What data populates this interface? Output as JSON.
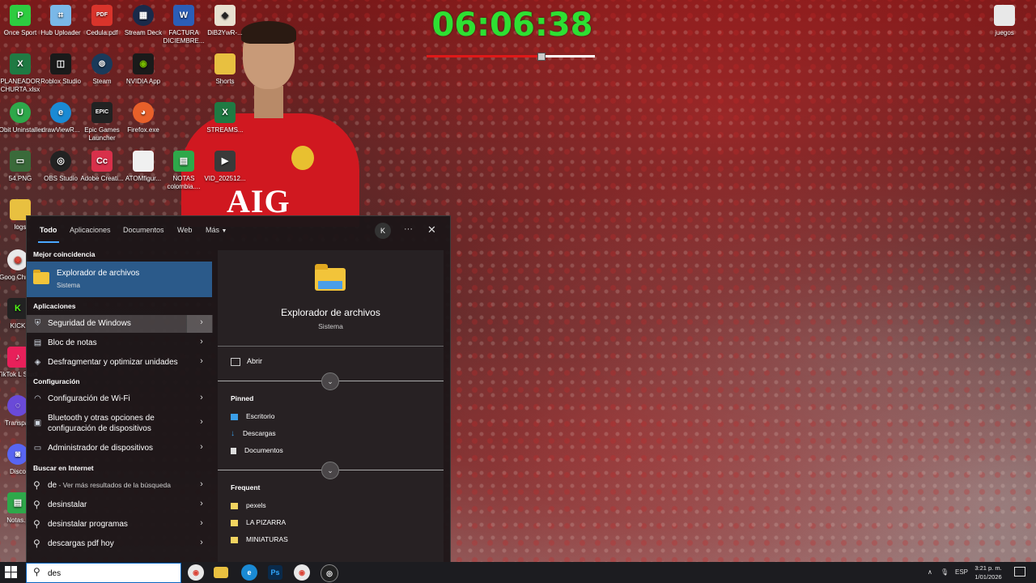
{
  "timer": {
    "value": "06:06:38",
    "progress": 0.68
  },
  "desktop": {
    "icons": [
      {
        "label": "Once Sport",
        "name": "once-sport-icon",
        "bg": "#2ecc40",
        "glyph": "P"
      },
      {
        "label": "Hub Uploader",
        "name": "hub-uploader-icon",
        "bg": "#7ab8e8",
        "glyph": "⌗"
      },
      {
        "label": "Cedula.pdf",
        "name": "pdf-file-icon",
        "bg": "#d9342b",
        "glyph": "PDF"
      },
      {
        "label": "Stream Deck",
        "name": "stream-deck-icon",
        "bg": "#1a2a4a",
        "glyph": "▦"
      },
      {
        "label": "FACTURA DICIEMBRE...",
        "name": "word-doc-icon",
        "bg": "#2b5eb8",
        "glyph": "W"
      },
      {
        "label": "DiB2YwR-...",
        "name": "image-file-icon",
        "bg": "#e8e0d0",
        "glyph": "◆"
      },
      {
        "label": "PLANEADOR CHURTA.xlsx",
        "name": "excel-file-icon",
        "bg": "#1f7a43",
        "glyph": "X"
      },
      {
        "label": "Roblox Studio",
        "name": "roblox-studio-icon",
        "bg": "#1a1a1a",
        "glyph": "◫"
      },
      {
        "label": "Steam",
        "name": "steam-icon",
        "bg": "#1a3a5a",
        "glyph": "⊚"
      },
      {
        "label": "NVIDIA App",
        "name": "nvidia-icon",
        "bg": "#1a1a1a",
        "glyph": "◉"
      },
      {
        "label": "Shorts",
        "name": "folder-icon",
        "bg": "#e8c040",
        "glyph": ""
      },
      {
        "label": "IObit Uninstaller",
        "name": "iobit-uninstaller-icon",
        "bg": "#2ea84a",
        "glyph": "U"
      },
      {
        "label": "drawViewR...",
        "name": "edge-shortcut-icon",
        "bg": "#1a8ad4",
        "glyph": "e"
      },
      {
        "label": "Epic Games Launcher",
        "name": "epic-games-icon",
        "bg": "#222",
        "glyph": "EPIC"
      },
      {
        "label": "Firefox.exe",
        "name": "firefox-icon",
        "bg": "#e8602a",
        "glyph": "◕"
      },
      {
        "label": "STREAMS...",
        "name": "excel-file-icon",
        "bg": "#1f7a43",
        "glyph": "X"
      },
      {
        "label": "54.PNG",
        "name": "image-file-icon",
        "bg": "#3a6a3a",
        "glyph": "▭"
      },
      {
        "label": "OBS Studio",
        "name": "obs-studio-icon",
        "bg": "#222",
        "glyph": "◎"
      },
      {
        "label": "Adobe Creati...",
        "name": "adobe-creative-icon",
        "bg": "#d8304a",
        "glyph": "Cc"
      },
      {
        "label": "ATOMfigur...",
        "name": "file-icon",
        "bg": "#f0f0f0",
        "glyph": ""
      },
      {
        "label": "NOTAS colombia....",
        "name": "spreadsheet-file-icon",
        "bg": "#2ea84a",
        "glyph": "▤"
      },
      {
        "label": "VID_202512...",
        "name": "video-file-icon",
        "bg": "#3a3a3a",
        "glyph": "▶"
      },
      {
        "label": "juegos",
        "name": "folder-icon",
        "bg": "#e8e8e8",
        "glyph": ""
      },
      {
        "label": "logs",
        "name": "logs-file-icon",
        "bg": "#e8c040",
        "glyph": ""
      },
      {
        "label": "Goog Chrom",
        "name": "chrome-icon",
        "bg": "#e8e8e8",
        "glyph": "◉"
      },
      {
        "label": "KICK",
        "name": "kick-icon",
        "bg": "#222",
        "glyph": "K"
      },
      {
        "label": "TikTok L Studi",
        "name": "tiktok-studio-icon",
        "bg": "#e8205a",
        "glyph": "♪"
      },
      {
        "label": "Transpar",
        "name": "transparency-icon",
        "bg": "#6a4ad8",
        "glyph": "◌"
      },
      {
        "label": "Disco",
        "name": "discord-icon",
        "bg": "#5865f2",
        "glyph": "◙"
      },
      {
        "label": "Notas.p",
        "name": "notes-file-icon",
        "bg": "#2ea84a",
        "glyph": "▤"
      }
    ]
  },
  "search_menu": {
    "tabs": [
      "Todo",
      "Aplicaciones",
      "Documentos",
      "Web",
      "Más"
    ],
    "avatar": "K",
    "more_glyph": "···",
    "close_glyph": "✕",
    "best_match_header": "Mejor coincidencia",
    "best_match": {
      "title": "Explorador de archivos",
      "subtitle": "Sistema"
    },
    "apps_header": "Aplicaciones",
    "apps": [
      {
        "label": "Seguridad de Windows",
        "icon": "shield-icon"
      },
      {
        "label": "Bloc de notas",
        "icon": "notepad-icon"
      },
      {
        "label": "Desfragmentar y optimizar unidades",
        "icon": "defrag-icon"
      }
    ],
    "settings_header": "Configuración",
    "settings": [
      {
        "label": "Configuración de Wi-Fi",
        "icon": "wifi-icon"
      },
      {
        "label": "Bluetooth y otras opciones de configuración de dispositivos",
        "line1": "Bluetooth y otras opciones de",
        "line2": "configuración de dispositivos",
        "icon": "bluetooth-icon"
      },
      {
        "label": "Administrador de dispositivos",
        "icon": "device-manager-icon"
      }
    ],
    "web_header": "Buscar en Internet",
    "web": [
      {
        "term": "de",
        "hint": " - Ver más resultados de la búsqueda"
      },
      {
        "term": "desinstalar"
      },
      {
        "term": "desinstalar programas"
      },
      {
        "term": "descargas pdf hoy"
      }
    ],
    "preview": {
      "title": "Explorador de archivos",
      "subtitle": "Sistema",
      "open_label": "Abrir",
      "pinned_header": "Pinned",
      "pinned": [
        "Escritorio",
        "Descargas",
        "Documentos"
      ],
      "frequent_header": "Frequent",
      "frequent": [
        "pexels",
        "LA PIZARRA",
        "MINIATURAS"
      ]
    }
  },
  "search_box": {
    "value": "des"
  },
  "taskbar": {
    "language": "ESP",
    "time": "3:21 p. m.",
    "date": "1/01/2026"
  },
  "colors": {
    "accent": "#4aa8ff",
    "best_match_bg": "#2b5a8a",
    "timer_green": "#2ee032",
    "timer_bar_red": "#e01818"
  }
}
